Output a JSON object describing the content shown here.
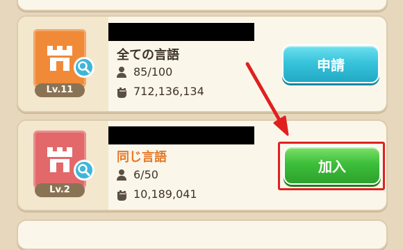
{
  "guilds": [
    {
      "level_label": "Lv.11",
      "language": "全ての言語",
      "members": "85/100",
      "power": "712,136,134",
      "button_label": "申請"
    },
    {
      "level_label": "Lv.2",
      "language": "同じ言語",
      "members": "6/50",
      "power": "10,189,041",
      "button_label": "加入"
    }
  ],
  "colors": {
    "accent_arrow": "#e0201f",
    "apply_button": "#38c4dc",
    "join_button": "#3dbf3a",
    "banner_1": "#f08a38",
    "banner_2": "#e3686a",
    "language_highlight": "#e57826"
  },
  "icons": {
    "emblem": "castle-icon",
    "inspect": "magnifier-icon",
    "members": "person-icon",
    "power": "fist-icon"
  }
}
